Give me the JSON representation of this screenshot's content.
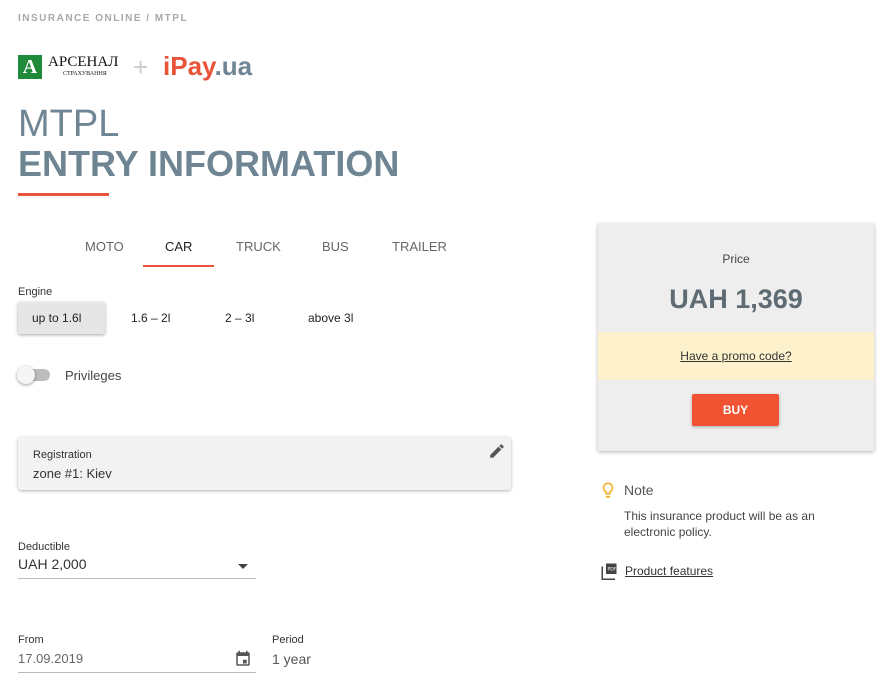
{
  "breadcrumb": "INSURANCE ONLINE / MTPL",
  "logos": {
    "arsenal": "АРСЕНАЛ",
    "arsenal_sub": "СТРАХУВАННЯ",
    "plus": "+",
    "ipay_i": "iPay",
    "ipay_ua": ".ua"
  },
  "title": "MTPL",
  "subtitle": "ENTRY INFORMATION",
  "tabs": [
    {
      "label": "MOTO"
    },
    {
      "label": "CAR",
      "active": true
    },
    {
      "label": "TRUCK"
    },
    {
      "label": "BUS"
    },
    {
      "label": "TRAILER"
    }
  ],
  "engine": {
    "label": "Engine",
    "options": [
      "up to 1.6l",
      "1.6 – 2l",
      "2 – 3l",
      "above 3l"
    ],
    "selected": "up to 1.6l"
  },
  "privileges": {
    "label": "Privileges",
    "on": false
  },
  "registration": {
    "label": "Registration",
    "value": "zone #1: Kiev"
  },
  "deductible": {
    "label": "Deductible",
    "value": "UAH 2,000"
  },
  "from": {
    "label": "From",
    "value": "17.09.2019"
  },
  "period": {
    "label": "Period",
    "value": "1 year"
  },
  "price": {
    "label": "Price",
    "value": "UAH 1,369",
    "promo": "Have a promo code?",
    "buy": "BUY"
  },
  "note": {
    "title": "Note",
    "text": "This insurance product will be as an electronic policy.",
    "link": "Product features"
  },
  "colors": {
    "accent": "#e8533a",
    "heading": "#6f8593",
    "promo_bg": "#fdf2cc"
  }
}
